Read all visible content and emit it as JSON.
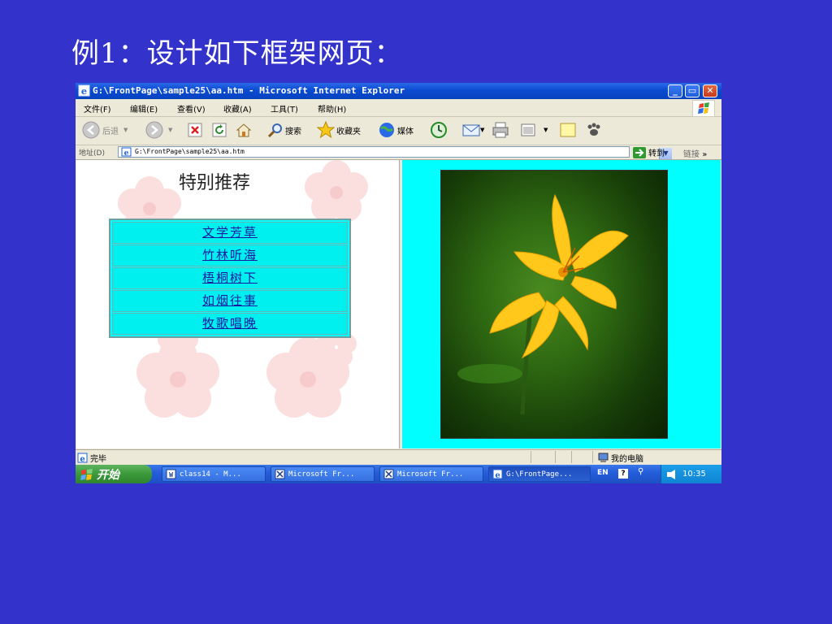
{
  "slide": {
    "title": "例1：设计如下框架网页："
  },
  "window": {
    "title": "G:\\FrontPage\\sample25\\aa.htm - Microsoft Internet Explorer",
    "controls": {
      "minimize": "_",
      "restore": "▭",
      "close": "✕"
    }
  },
  "menu": {
    "items": [
      "文件(F)",
      "编辑(E)",
      "查看(V)",
      "收藏(A)",
      "工具(T)",
      "帮助(H)"
    ]
  },
  "toolbar": {
    "back_label": "后退",
    "search_label": "搜索",
    "favorites_label": "收藏夹",
    "media_label": "媒体"
  },
  "address": {
    "label": "地址(D)",
    "value": "G:\\FrontPage\\sample25\\aa.htm",
    "go_label": "转到",
    "links_label": "链接",
    "links_more": "»"
  },
  "left_frame": {
    "heading": "特别推荐",
    "nav_items": [
      "文学芳草",
      "竹林听海",
      "梧桐树下",
      "如烟往事",
      "牧歌唱晚"
    ]
  },
  "status": {
    "text": "完毕",
    "zone": "我的电脑"
  },
  "taskbar": {
    "start_label": "开始",
    "tasks": [
      "class14 - M...",
      "Microsoft Fr...",
      "Microsoft Fr...",
      "G:\\FrontPage..."
    ],
    "lang": "EN",
    "help": "?",
    "clock": "10:35"
  },
  "colors": {
    "slide_bg": "#3333cc",
    "frame_bg": "#00ffff",
    "nav_link": "#1a1aa0"
  }
}
